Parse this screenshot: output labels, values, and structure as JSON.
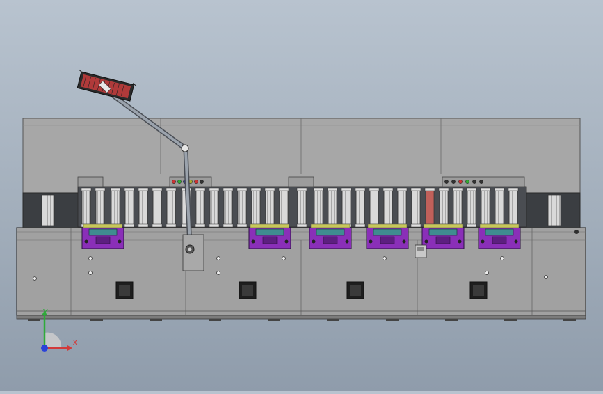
{
  "view": {
    "type": "cad-orthographic-front-view",
    "background": "#a9b4c1"
  },
  "machine": {
    "colors": {
      "upper_panel": "#a7a7a7",
      "lower_panel": "#a1a1a1",
      "dark_band": "#3b3e42",
      "line": "#555555",
      "clamp_purple": "#8a2fb8",
      "clamp_teal": "#3f8c90",
      "red_roller": "#c0605a",
      "hatch_red": "#b03a3a"
    },
    "lower_clamp_modules": 6,
    "access_hatches": 4,
    "red_rollers": 1
  },
  "triad": {
    "x_label": "X",
    "y_label": "Y",
    "x_color": "#d23a3a",
    "y_color": "#2faa3a",
    "z_color": "#2b43d8"
  }
}
